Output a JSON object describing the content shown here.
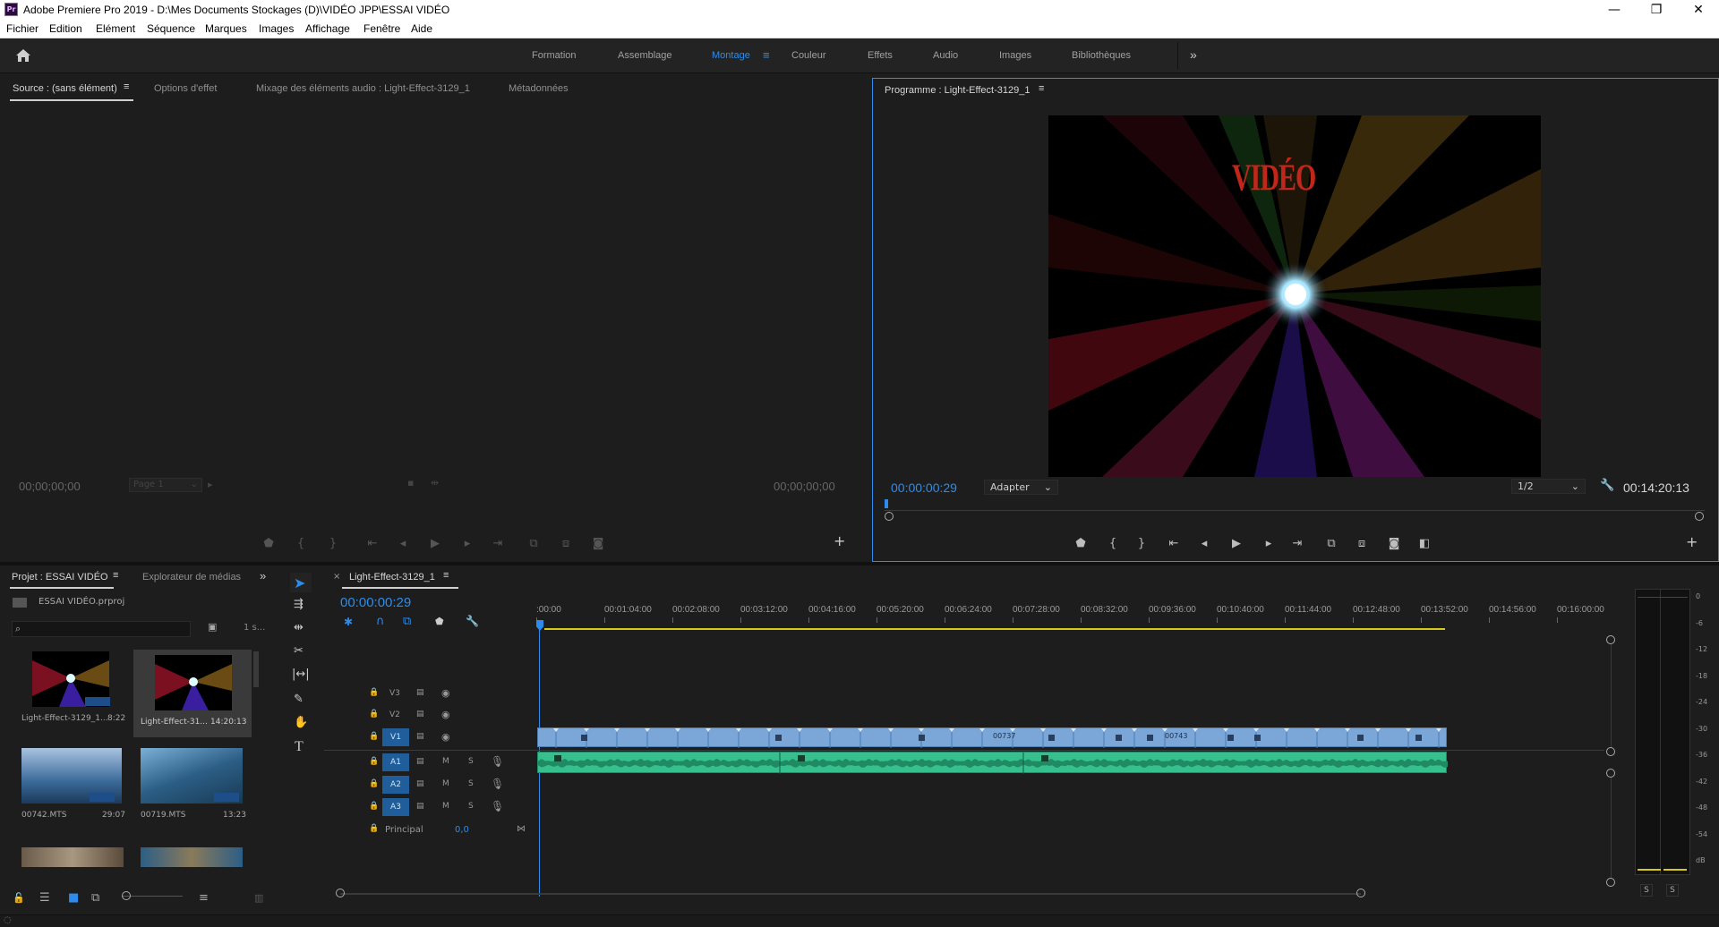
{
  "app": {
    "title": "Adobe Premiere Pro 2019 - D:\\Mes Documents Stockages (D)\\VIDÉO JPP\\ESSAI VIDÉO",
    "icon": "Pr"
  },
  "menu": [
    "Fichier",
    "Edition",
    "Elément",
    "Séquence",
    "Marques",
    "Images",
    "Affichage",
    "Fenêtre",
    "Aide"
  ],
  "workspaces": [
    "Formation",
    "Assemblage",
    "Montage",
    "Couleur",
    "Effets",
    "Audio",
    "Images",
    "Bibliothèques"
  ],
  "active_workspace": "Montage",
  "source_panel": {
    "tabs": [
      "Source : (sans élément)",
      "Options d'effet",
      "Mixage des éléments audio : Light-Effect-3129_1",
      "Métadonnées"
    ],
    "timecode_left": "00;00;00;00",
    "timecode_right": "00;00;00;00",
    "page_select": "Page 1"
  },
  "program_panel": {
    "tab": "Programme : Light-Effect-3129_1",
    "overlay_text": "VIDÉO",
    "timecode": "00:00:00:29",
    "fit": "Adapter",
    "resolution": "1/2",
    "duration": "00:14:20:13"
  },
  "project_panel": {
    "tabs": [
      "Projet : ESSAI VIDÉO",
      "Explorateur de médias"
    ],
    "file": "ESSAI VIDÉO.prproj",
    "count": "1 s...",
    "items": [
      {
        "name": "Light-Effect-3129_1...",
        "dur": "8:22"
      },
      {
        "name": "Light-Effect-31...",
        "dur": "14:20:13"
      },
      {
        "name": "00742.MTS",
        "dur": "29:07"
      },
      {
        "name": "00719.MTS",
        "dur": "13:23"
      }
    ]
  },
  "timeline": {
    "tab": "Light-Effect-3129_1",
    "timecode": "00:00:00:29",
    "ruler": [
      ":00:00",
      "00:01:04:00",
      "00:02:08:00",
      "00:03:12:00",
      "00:04:16:00",
      "00:05:20:00",
      "00:06:24:00",
      "00:07:28:00",
      "00:08:32:00",
      "00:09:36:00",
      "00:10:40:00",
      "00:11:44:00",
      "00:12:48:00",
      "00:13:52:00",
      "00:14:56:00",
      "00:16:00:00"
    ],
    "video_tracks": [
      "V3",
      "V2",
      "V1"
    ],
    "audio_tracks": [
      "A1",
      "A2",
      "A3"
    ],
    "master_label": "Principal",
    "master_value": "0,0",
    "clip_labels": [
      "00737",
      "00743"
    ],
    "m": "M",
    "s": "S"
  },
  "vu": {
    "scale": [
      "0",
      "-6",
      "-12",
      "-18",
      "-24",
      "-30",
      "-36",
      "-42",
      "-48",
      "-54",
      "dB"
    ],
    "solo": [
      "S",
      "S"
    ]
  },
  "colors": {
    "accent": "#2d8ceb",
    "video_clip": "#7aa6d8",
    "audio_clip": "#35c08e"
  }
}
